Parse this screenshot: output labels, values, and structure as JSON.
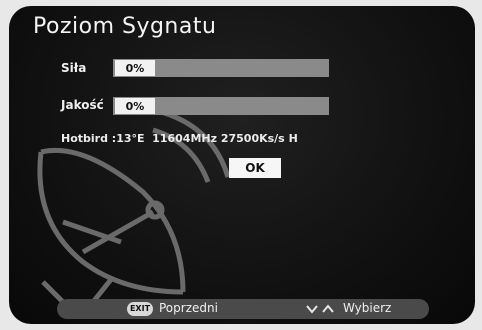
{
  "title": "Poziom Sygnatu",
  "strength": {
    "label": "Siła",
    "percent_text": "0%",
    "level": 0
  },
  "quality": {
    "label": "Jakość",
    "percent_text": "0%",
    "level": 0
  },
  "transponder_info": "Hotbird :13°E  11604MHz 27500Ks/s H",
  "ok_button": "OK",
  "footer": {
    "exit_key": "EXIT",
    "back_label": "Poprzedni",
    "select_label": "Wybierz"
  },
  "colors": {
    "screen": "#121212",
    "bar_track": "#8a8a8a",
    "footer": "#4a4a4a"
  },
  "icons": {
    "exit": "exit-key-icon",
    "nav": "up-down-arrows-icon",
    "dish": "satellite-dish-icon"
  }
}
